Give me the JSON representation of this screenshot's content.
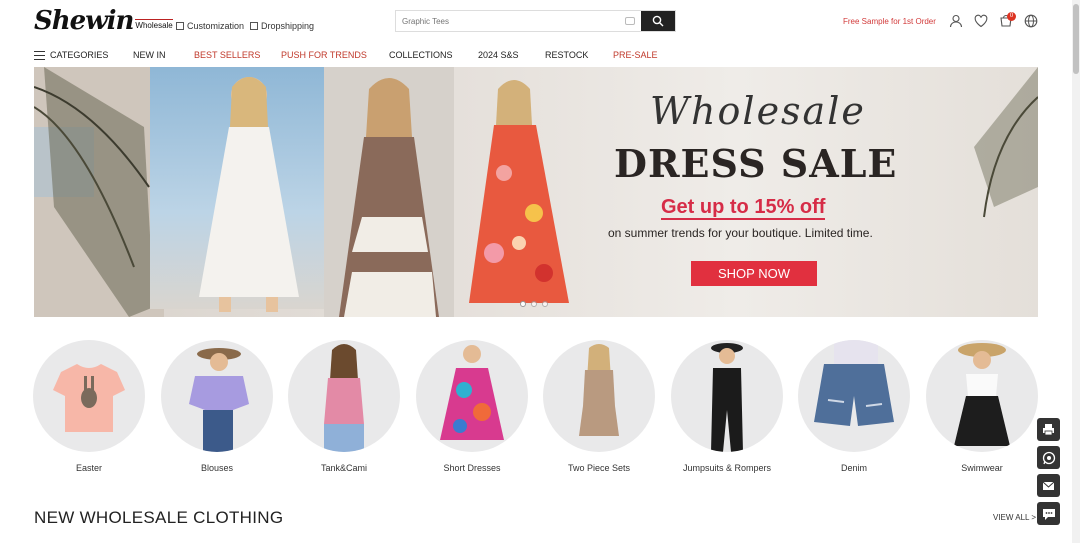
{
  "header": {
    "logo_main": "Shewin",
    "logo_sub": "Wholesale",
    "links": [
      "Customization",
      "Dropshipping"
    ],
    "search_placeholder": "Graphic Tees",
    "promo": "Free Sample for 1st Order",
    "cart_count": "0"
  },
  "nav": {
    "items": [
      "CATEGORIES",
      "NEW IN",
      "BEST SELLERS",
      "PUSH FOR TRENDS",
      "COLLECTIONS",
      "2024 S&S",
      "RESTOCK",
      "PRE-SALE"
    ]
  },
  "hero": {
    "script": "Wholesale",
    "headline": "DRESS SALE",
    "offer": "Get up to 15% off",
    "subtext": "on summer trends for your boutique. Limited time.",
    "cta": "SHOP NOW"
  },
  "categories": [
    "Easter",
    "Blouses",
    "Tank&Cami",
    "Short Dresses",
    "Two Piece Sets",
    "Jumpsuits & Rompers",
    "Denim",
    "Swimwear"
  ],
  "section": {
    "title": "NEW WHOLESALE CLOTHING",
    "view_all": "VIEW ALL >"
  },
  "colors": {
    "accent": "#d23a3a",
    "cta": "#e1303f"
  }
}
